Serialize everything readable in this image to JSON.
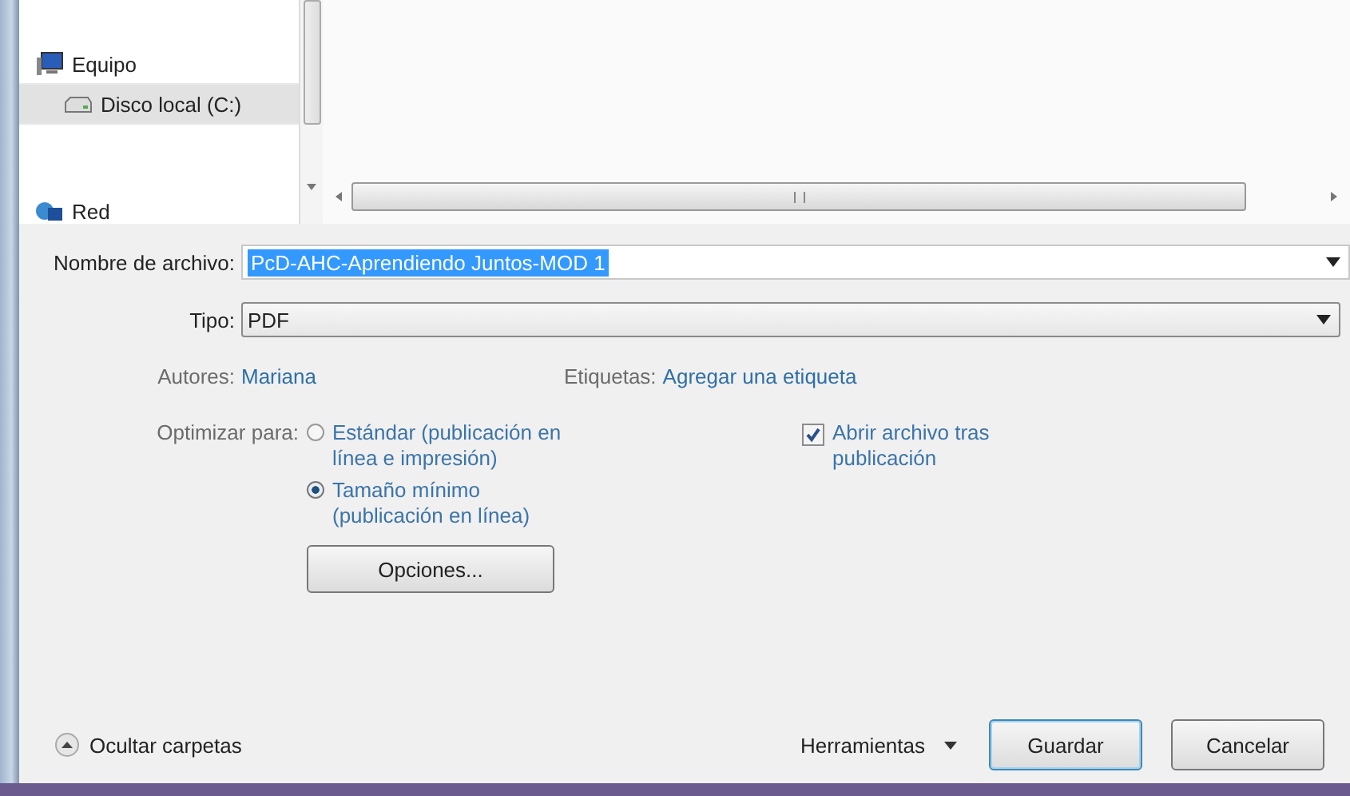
{
  "nav_items": [
    {
      "label": "Equipo",
      "kind": "computer",
      "selected": false,
      "children": [
        {
          "label": "Disco local (C:)",
          "kind": "drive",
          "selected": true
        }
      ]
    },
    {
      "label": "Red",
      "kind": "network",
      "selected": false
    }
  ],
  "filename": {
    "label": "Nombre de archivo:",
    "value": "PcD-AHC-Aprendiendo Juntos-MOD 1",
    "text_selected": true
  },
  "file_type": {
    "label": "Tipo:",
    "value": "PDF"
  },
  "authors": {
    "label": "Autores:",
    "value": "Mariana"
  },
  "tags": {
    "label": "Etiquetas:",
    "value": "Agregar una etiqueta"
  },
  "optimize": {
    "label": "Optimizar para:",
    "options": [
      {
        "label": "Estándar (publicación en línea e impresión)",
        "selected": false
      },
      {
        "label": "Tamaño mínimo (publicación en línea)",
        "selected": true
      }
    ]
  },
  "open_after": {
    "label": "Abrir archivo tras publicación",
    "checked": true
  },
  "options_button": "Opciones...",
  "hide_folders": "Ocultar carpetas",
  "tools": "Herramientas",
  "buttons": [
    {
      "label": "Guardar",
      "default": true
    },
    {
      "label": "Cancelar",
      "default": false
    }
  ]
}
